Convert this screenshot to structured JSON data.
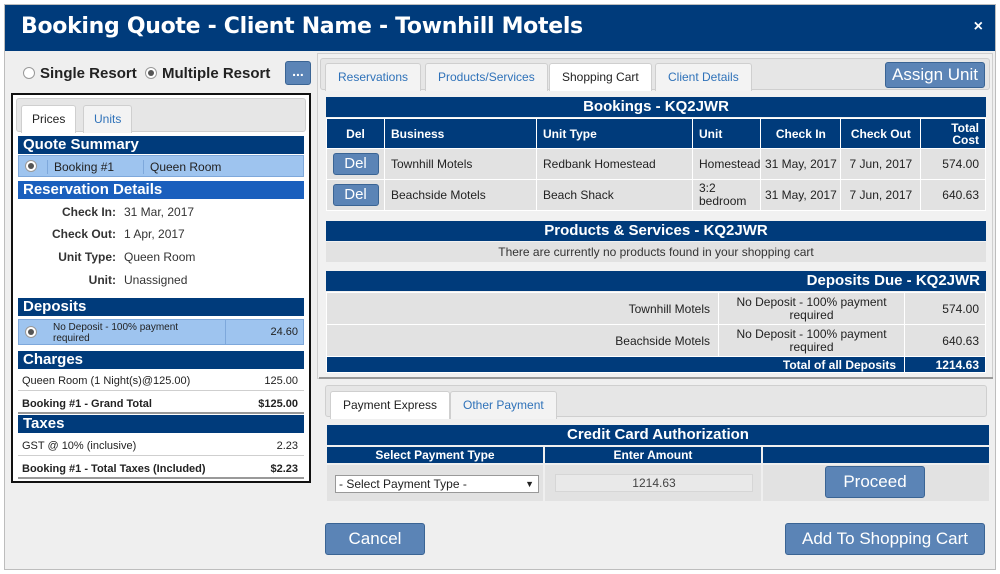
{
  "title": "Booking Quote - Client Name - Townhill Motels",
  "close_icon": "×",
  "resort": {
    "single_label": "Single Resort",
    "multiple_label": "Multiple Resort",
    "selected": "multiple",
    "more_label": "..."
  },
  "left": {
    "tabs": [
      "Prices",
      "Units"
    ],
    "quote_summary_title": "Quote Summary",
    "booking_label": "Booking #1",
    "booking_unit": "Queen Room",
    "reservation_title": "Reservation Details",
    "details": [
      {
        "k": "Check In:",
        "v": "31 Mar, 2017"
      },
      {
        "k": "Check Out:",
        "v": "1 Apr, 2017"
      },
      {
        "k": "Unit Type:",
        "v": "Queen Room"
      },
      {
        "k": "Unit:",
        "v": "Unassigned"
      }
    ],
    "deposits_title": "Deposits",
    "deposit_text": "No Deposit - 100% payment required",
    "deposit_amount": "24.60",
    "charges_title": "Charges",
    "charge_line": "Queen Room (1 Night(s)@125.00)",
    "charge_amount": "125.00",
    "grand_total_label": "Booking #1 - Grand Total",
    "grand_total_amount": "$125.00",
    "taxes_title": "Taxes",
    "tax_line": "GST @ 10% (inclusive)",
    "tax_amount": "2.23",
    "tax_total_label": "Booking #1 - Total Taxes (Included)",
    "tax_total_amount": "$2.23"
  },
  "right": {
    "tabs": [
      "Reservations",
      "Products/Services",
      "Shopping Cart",
      "Client Details"
    ],
    "assign_label": "Assign Unit",
    "bookings_title": "Bookings - KQ2JWR",
    "columns": [
      "Del",
      "Business",
      "Unit Type",
      "Unit",
      "Check In",
      "Check Out",
      "Total Cost"
    ],
    "rows": [
      {
        "del": "Del",
        "business": "Townhill Motels",
        "unit_type": "Redbank Homestead",
        "unit": "Homestead",
        "check_in": "31 May, 2017",
        "check_out": "7 Jun, 2017",
        "total": "574.00"
      },
      {
        "del": "Del",
        "business": "Beachside Motels",
        "unit_type": "Beach Shack",
        "unit": "3:2 bedroom",
        "check_in": "31 May, 2017",
        "check_out": "7 Jun, 2017",
        "total": "640.63"
      }
    ],
    "products_title": "Products & Services - KQ2JWR",
    "products_empty": "There are currently no products found in your shopping cart",
    "deposits_title": "Deposits Due - KQ2JWR",
    "deposits": [
      {
        "name": "Townhill Motels",
        "msg": "No Deposit - 100% payment required",
        "amount": "574.00"
      },
      {
        "name": "Beachside Motels",
        "msg": "No Deposit - 100% payment required",
        "amount": "640.63"
      }
    ],
    "total_deposits_label": "Total of all Deposits",
    "total_deposits_amount": "1214.63"
  },
  "payment": {
    "tabs": [
      "Payment Express",
      "Other Payment"
    ],
    "cc_title": "Credit Card Authorization",
    "col_type": "Select Payment Type",
    "col_amount": "Enter Amount",
    "select_value": "- Select Payment Type -",
    "amount_value": "1214.63",
    "proceed_label": "Proceed"
  },
  "footer": {
    "cancel_label": "Cancel",
    "add_label": "Add To Shopping Cart"
  },
  "colors": {
    "primary": "#003b7b",
    "button": "#5b84b6",
    "highlight": "#9ec4ef"
  }
}
